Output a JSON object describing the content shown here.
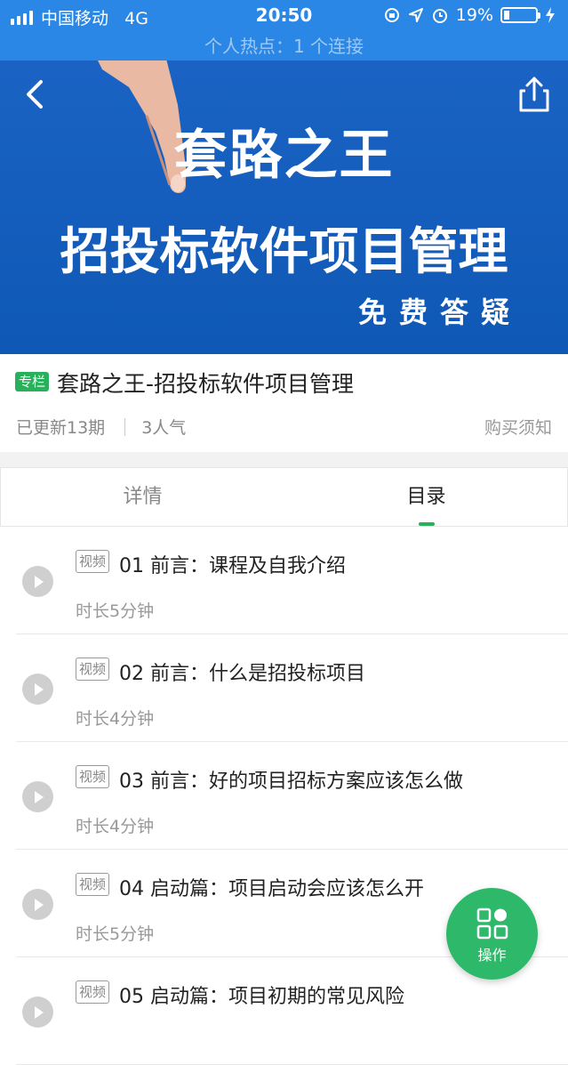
{
  "status_bar": {
    "carrier": "中国移动",
    "network": "4G",
    "time": "20:50",
    "battery_percent": "19%",
    "battery_level": 0.19,
    "hotspot_text": "个人热点：1 个连接"
  },
  "banner": {
    "line1": "套路之王",
    "line2": "招投标软件项目管理",
    "line3": "免费答疑",
    "background_color": "#1a63c4"
  },
  "info": {
    "tag": "专栏",
    "title": "套路之王-招投标软件项目管理",
    "updated": "已更新13期",
    "popularity": "3人气",
    "buy_note": "购买须知"
  },
  "tabs": [
    {
      "label": "详情",
      "active": false
    },
    {
      "label": "目录",
      "active": true
    }
  ],
  "accent_color": "#28b15a",
  "items": [
    {
      "tag": "视频",
      "title": "01 前言：课程及自我介绍",
      "duration": "时长5分钟"
    },
    {
      "tag": "视频",
      "title": "02 前言：什么是招投标项目",
      "duration": "时长4分钟"
    },
    {
      "tag": "视频",
      "title": "03 前言：好的项目招标方案应该怎么做",
      "duration": "时长4分钟"
    },
    {
      "tag": "视频",
      "title": "04 启动篇：项目启动会应该怎么开",
      "duration": "时长5分钟"
    },
    {
      "tag": "视频",
      "title": "05 启动篇：项目初期的常见风险",
      "duration": ""
    }
  ],
  "fab": {
    "label": "操作"
  }
}
